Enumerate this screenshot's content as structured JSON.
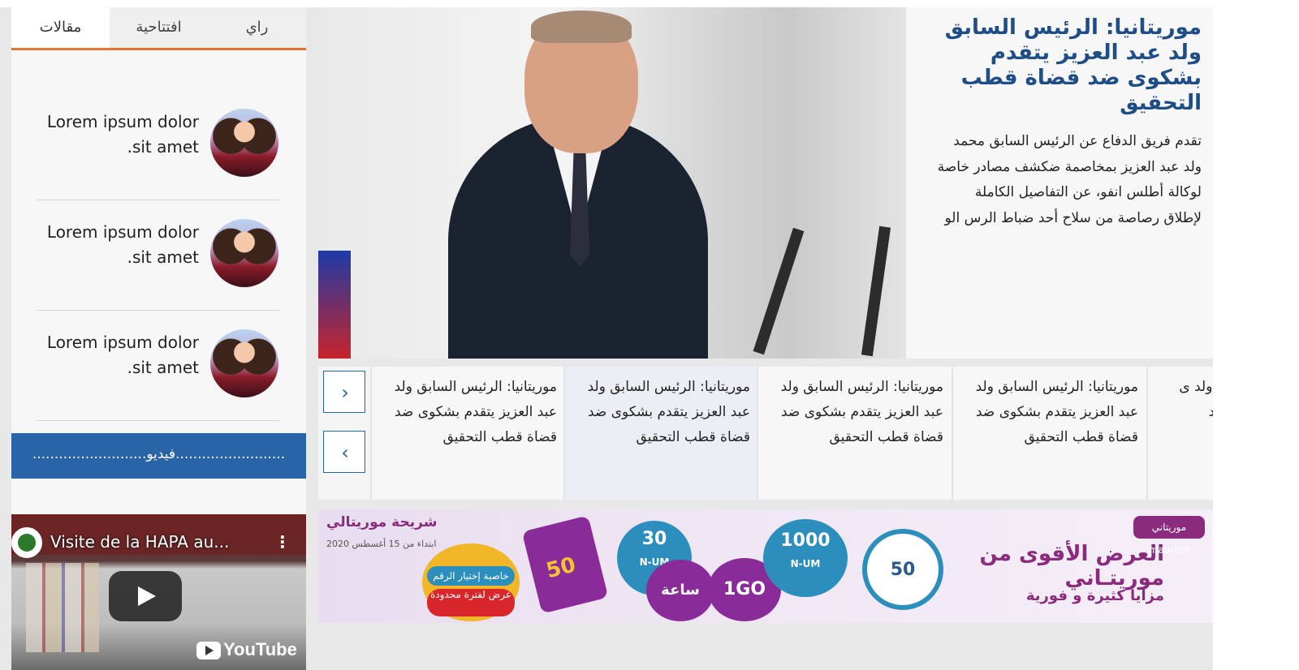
{
  "tabs": [
    {
      "label": "راي"
    },
    {
      "label": "افتتاحية"
    },
    {
      "label": "مقالات"
    }
  ],
  "articles": [
    {
      "title": "Lorem ipsum dolor sit amet."
    },
    {
      "title": "Lorem ipsum dolor sit amet."
    },
    {
      "title": "Lorem ipsum dolor sit amet."
    }
  ],
  "video_section": {
    "label": "..........................فيديو.........................",
    "video_title": "Visite de la HAPA au...",
    "menu_icon": "⋮",
    "youtube_label": "YouTube"
  },
  "featured": {
    "title": "موريتانيا: الرئيس السابق ولد عبد العزيز يتقدم بشكوى ضد قضاة قطب التحقيق",
    "body": "تقدم فريق الدفاع عن الرئيس السابق محمد ولد عبد العزيز بمخاصمة ضكشف مصادر خاصة لوكالة أطلس انفو، عن التفاصيل الكاملة لإطلاق رصاصة من سلاح أحد ضباط الرس الو"
  },
  "slider": {
    "items": [
      {
        "title": "موريتانيا: الرئيس السابق ولد عبد العزيز يتقدم بشكوى ضد قضاة قطب التحقيق"
      },
      {
        "title": "موريتانيا: الرئيس السابق ولد عبد العزيز يتقدم بشكوى ضد قضاة قطب التحقيق"
      },
      {
        "title": "موريتانيا: الرئيس السابق ولد عبد العزيز يتقدم بشكوى ضد قضاة قطب التحقيق"
      },
      {
        "title": "موريتانيا: الرئيس السابق ولد عبد العزيز يتقدم بشكوى ضد قضاة قطب التحقيق"
      },
      {
        "title": "ق ولد ى ضد"
      }
    ],
    "next_icon": "›",
    "prev_icon": "‹"
  },
  "ad": {
    "brand_small": "شريحة موريتالي",
    "date": "ابتداء من 15 أغسطس 2020",
    "offer_pill1": "خاصية إختيار الرقم متاحة",
    "offer_pill2": "عرض لفترة محدودة",
    "sim_value": "50",
    "bubble_30": "30",
    "bubble_30_sub": "N-UM",
    "bubble_hour": "ساعة",
    "bubble_1go": "1GO",
    "bubble_1000": "1000",
    "bubble_1000_sub": "N-UM",
    "bubble_50": "50",
    "headline": "العرض الأقوى من موريتـاني",
    "sub": "مزايا كثيرة و فورية",
    "logo": "موريتاني mauritel"
  },
  "colors": {
    "accent_orange": "#e8742f",
    "blue": "#2a64a8",
    "headline_blue": "#1f4d86",
    "ad_purple": "#8a2b7d"
  }
}
